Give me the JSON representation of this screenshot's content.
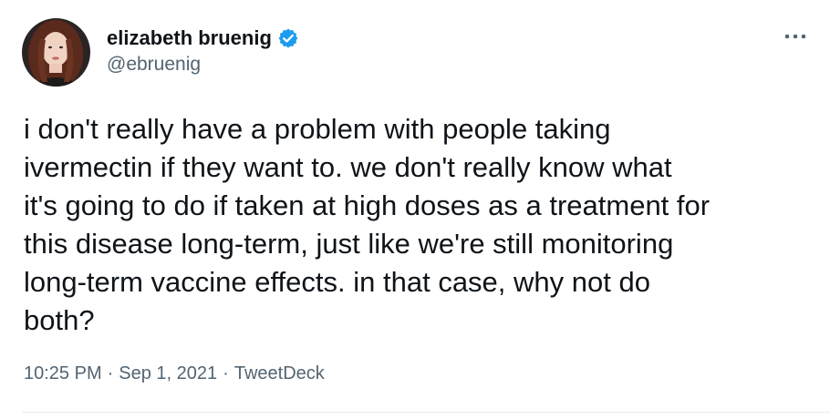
{
  "author": {
    "display_name": "elizabeth bruenig",
    "handle": "@ebruenig",
    "verified": true,
    "avatar_icon": "profile-photo"
  },
  "tweet": {
    "text": "i don't really have a problem with people taking\nivermectin if they want to. we don't really know what\nit's going to do if taken at high doses as a treatment for\nthis disease long-term, just like we're still monitoring\nlong-term vaccine effects. in that case, why not do\nboth?",
    "time": "10:25 PM",
    "date": "Sep 1, 2021",
    "source": "TweetDeck",
    "separator": "·"
  },
  "icons": {
    "more": "more-horizontal-icon",
    "verified": "verified-badge-icon"
  },
  "colors": {
    "verified_blue": "#1d9bf0",
    "text_primary": "#0f1419",
    "text_secondary": "#536471"
  }
}
